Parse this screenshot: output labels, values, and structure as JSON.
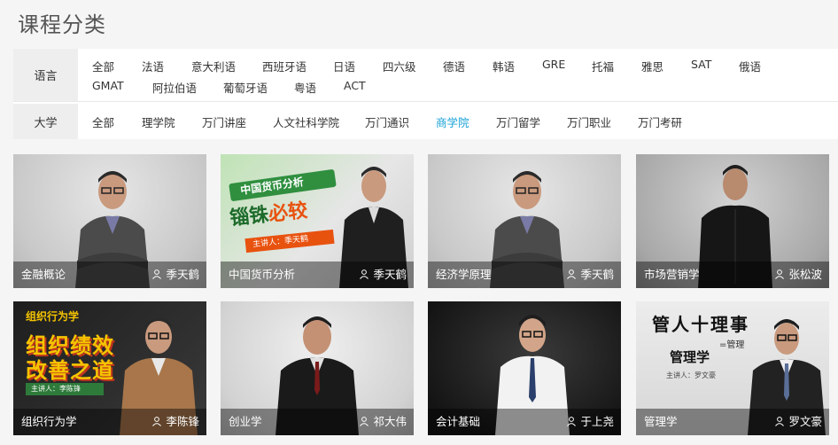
{
  "page": {
    "title": "课程分类"
  },
  "filters": {
    "language": {
      "label": "语言",
      "options": [
        "全部",
        "法语",
        "意大利语",
        "西班牙语",
        "日语",
        "四六级",
        "德语",
        "韩语",
        "GRE",
        "托福",
        "雅思",
        "SAT",
        "俄语",
        "GMAT",
        "阿拉伯语",
        "葡萄牙语",
        "粤语",
        "ACT"
      ]
    },
    "university": {
      "label": "大学",
      "options": [
        "全部",
        "理学院",
        "万门讲座",
        "人文社科学院",
        "万门通识",
        "商学院",
        "万门留学",
        "万门职业",
        "万门考研"
      ],
      "active_index": 5
    }
  },
  "accent_color": "#1aa3d6",
  "courses": [
    {
      "course": "金融概论",
      "teacher": "季天鹤"
    },
    {
      "course": "中国货币分析",
      "teacher": "季天鹤",
      "poster": {
        "heading": "中国货币分析",
        "main": "锱铢",
        "highlight": "必较",
        "byline": "主讲人：季天鹤"
      }
    },
    {
      "course": "经济学原理",
      "teacher": "季天鹤"
    },
    {
      "course": "市场营销学",
      "teacher": "张松波"
    },
    {
      "course": "组织行为学",
      "teacher": "李陈锋",
      "poster": {
        "heading": "组织行为学",
        "main": "组织绩效",
        "main2": "改善之道",
        "byline": "主讲人：李陈锋"
      }
    },
    {
      "course": "创业学",
      "teacher": "祁大伟"
    },
    {
      "course": "会计基础",
      "teacher": "于上尧"
    },
    {
      "course": "管理学",
      "teacher": "罗文豪",
      "poster": {
        "heading": "管人十理事",
        "eq": "=管理",
        "main": "管理学",
        "byline": "主讲人：罗文豪"
      }
    }
  ]
}
